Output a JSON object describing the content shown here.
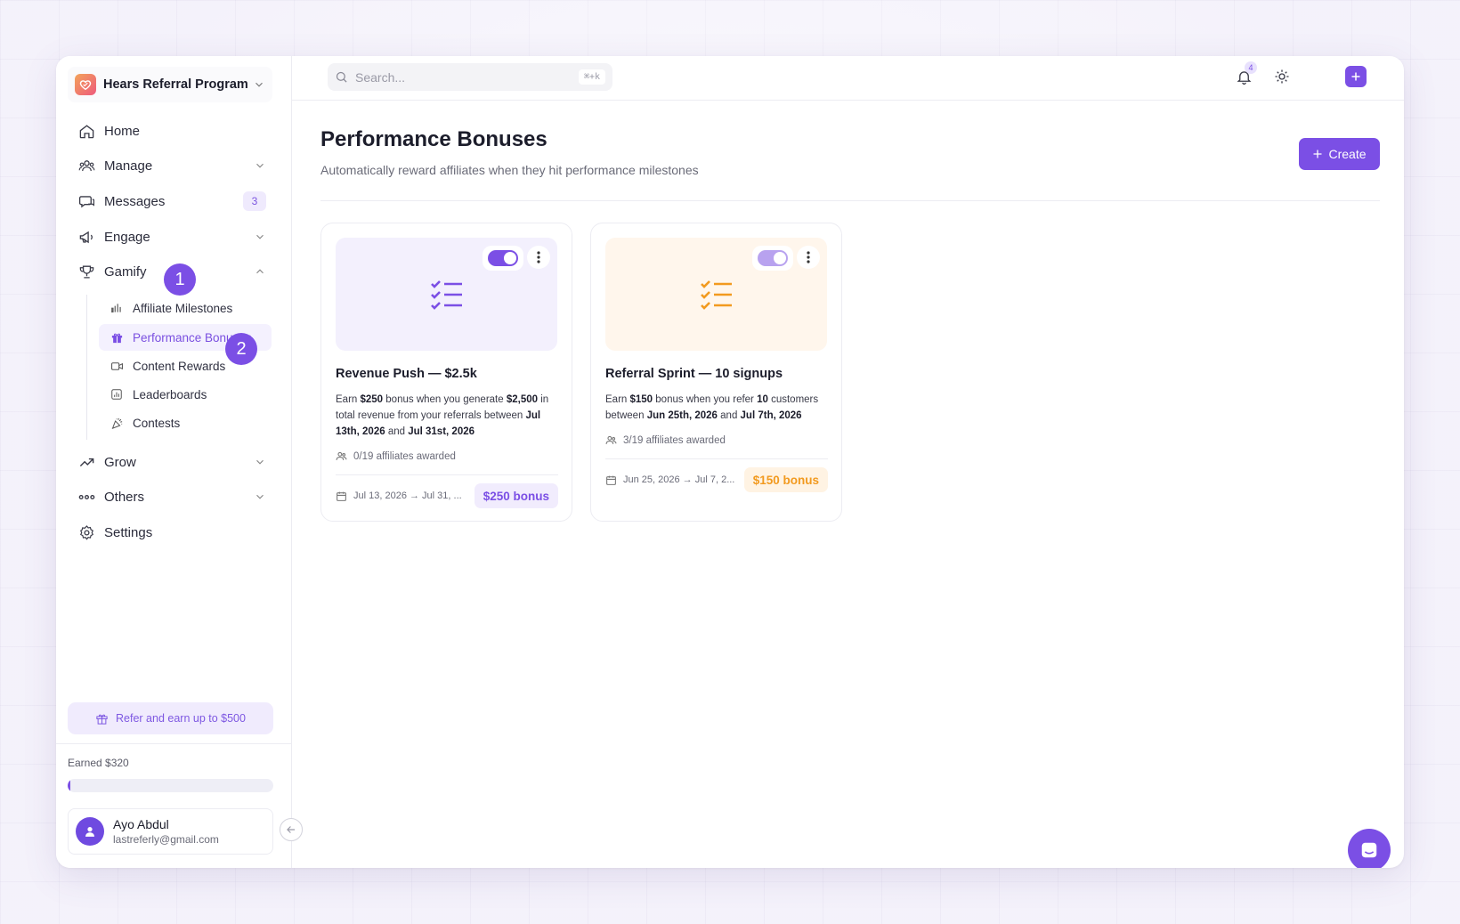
{
  "workspace": {
    "name": "Hears Referral Program"
  },
  "nav": {
    "home": "Home",
    "manage": "Manage",
    "messages": "Messages",
    "messages_count": "3",
    "engage": "Engage",
    "gamify": "Gamify",
    "gamify_items": {
      "milestones": "Affiliate Milestones",
      "bonuses": "Performance Bonuses",
      "content": "Content Rewards",
      "leaderboards": "Leaderboards",
      "contests": "Contests"
    },
    "grow": "Grow",
    "others": "Others",
    "settings": "Settings"
  },
  "steps": [
    "1",
    "2"
  ],
  "refer": {
    "label": "Refer and earn up to $500"
  },
  "earnings": {
    "label": "Earned $320",
    "progress_fraction": 0.01
  },
  "user": {
    "name": "Ayo Abdul",
    "email": "lastreferly@gmail.com"
  },
  "topbar": {
    "search_placeholder": "Search...",
    "shortcut": "⌘+k",
    "notifications_count": "4"
  },
  "page": {
    "title": "Performance Bonuses",
    "subtitle": "Automatically reward affiliates when they hit performance milestones",
    "create_label": "Create"
  },
  "cards": [
    {
      "title": "Revenue Push — $2.5k",
      "desc": [
        {
          "t": "Earn ",
          "b": false
        },
        {
          "t": "$250",
          "b": true
        },
        {
          "t": " bonus when you generate ",
          "b": false
        },
        {
          "t": "$2,500",
          "b": true
        },
        {
          "t": " in total revenue from your referrals between ",
          "b": false
        },
        {
          "t": "Jul 13th, 2026",
          "b": true
        },
        {
          "t": " and ",
          "b": false
        },
        {
          "t": "Jul 31st, 2026",
          "b": true
        }
      ],
      "awarded": "0/19 affiliates awarded",
      "dates": "Jul 13, 2026 → Jul 31, ...",
      "bonus": "$250 bonus",
      "enabled": true,
      "accent": "#7b4fe5",
      "hero_bg": "#f3f0fd",
      "pill_bg": "#f1ecfd"
    },
    {
      "title": "Referral Sprint — 10 signups",
      "desc": [
        {
          "t": "Earn ",
          "b": false
        },
        {
          "t": "$150",
          "b": true
        },
        {
          "t": " bonus when you refer ",
          "b": false
        },
        {
          "t": "10",
          "b": true
        },
        {
          "t": " customers between ",
          "b": false
        },
        {
          "t": "Jun 25th, 2026",
          "b": true
        },
        {
          "t": " and ",
          "b": false
        },
        {
          "t": "Jul 7th, 2026",
          "b": true
        }
      ],
      "awarded": "3/19 affiliates awarded",
      "dates": "Jun 25, 2026 → Jul 7, 2...",
      "bonus": "$150 bonus",
      "enabled": true,
      "accent": "#f29a1f",
      "hero_bg": "#fff6ec",
      "pill_bg": "#fff3e3"
    }
  ],
  "colors": {
    "accent": "#7b4fe5",
    "orange": "#f29a1f"
  }
}
